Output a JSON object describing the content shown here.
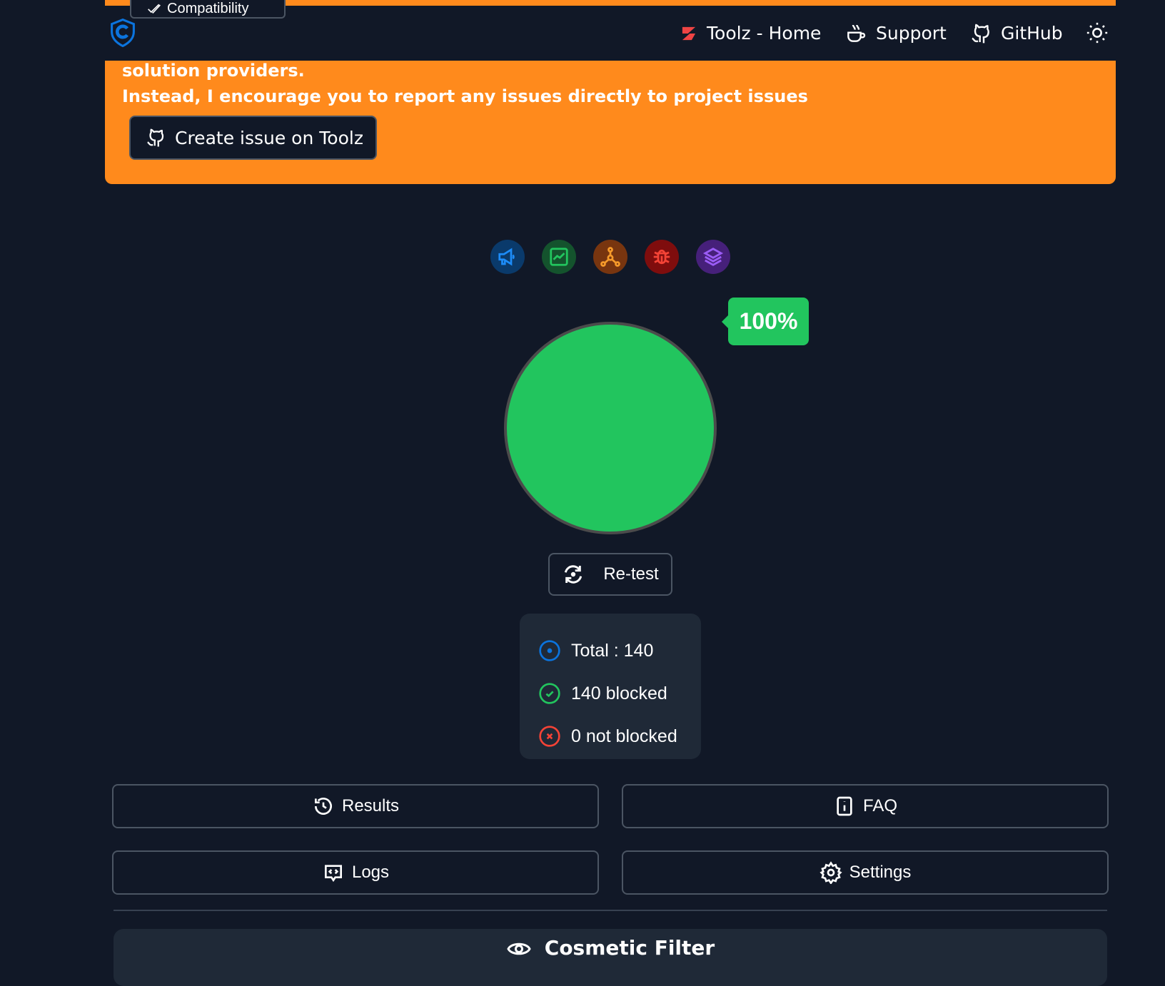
{
  "top_tab": {
    "label": "Compatibility"
  },
  "nav": {
    "home": "Toolz - Home",
    "support": "Support",
    "github": "GitHub"
  },
  "banner": {
    "line1": "solution providers.",
    "line2": "Instead, I encourage you to report any issues directly to project issues",
    "button": "Create issue on Toolz"
  },
  "colors": {
    "accent_orange": "#ff8a1c",
    "success": "#22c55e",
    "bg": "#111827",
    "panel": "#1f2937"
  },
  "icons": [
    "megaphone-icon",
    "chart-icon",
    "network-icon",
    "bug-icon",
    "layers-icon"
  ],
  "result": {
    "percent_label": "100%",
    "blocked_fraction": 1.0
  },
  "retest": "Re-test",
  "stats": {
    "total": "Total : 140",
    "blocked": "140 blocked",
    "not_blocked": "0 not blocked"
  },
  "buttons": {
    "results": "Results",
    "faq": "FAQ",
    "logs": "Logs",
    "settings": "Settings"
  },
  "cosmetic": {
    "title": "Cosmetic Filter"
  }
}
